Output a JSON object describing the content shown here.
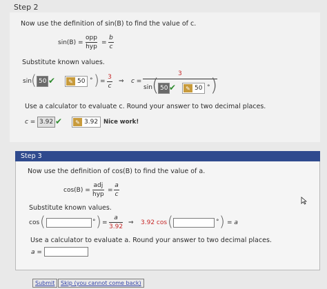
{
  "step2": {
    "label": "Step 2",
    "instruction": "Now use the definition of sin(B) to find the value of c.",
    "def_lhs": "sin(B) =",
    "def_num1": "opp",
    "def_den1": "hyp",
    "def_eq": "=",
    "def_num2": "b",
    "def_den2": "c",
    "substitute": "Substitute known values.",
    "sin": "sin",
    "angle_value": "50",
    "angle_input": "50",
    "degree": "°",
    "eq": "=",
    "num3": "3",
    "den_c": "c",
    "arrow": "⇒",
    "c_eq": "c =",
    "num3b": "3",
    "sin2": "sin",
    "angle_value2": "50",
    "angle_input2": "50",
    "calc_instruction": "Use a calculator to evaluate c. Round your answer to two decimal places.",
    "c_label": "c =",
    "c_value": "3.92",
    "c_input": "3.92",
    "feedback": "Nice work!"
  },
  "step3": {
    "title": "Step 3",
    "instruction": "Now use the definition of cos(B) to find the value of a.",
    "def_lhs": "cos(B) =",
    "def_num1": "adj",
    "def_den1": "hyp",
    "def_eq": "=",
    "def_num2": "a",
    "def_den2": "c",
    "substitute": "Substitute known values.",
    "cos": "cos",
    "degree": "°",
    "eq": "=",
    "num_a": "a",
    "den_392": "3.92",
    "arrow": "⇒",
    "coef": "3.92 cos",
    "rhs": "= a",
    "calc_instruction": "Use a calculator to evaluate a. Round your answer to two decimal places.",
    "a_label": "a ="
  },
  "footer": {
    "submit": "Submit",
    "skip": "Skip (you cannot come back)"
  }
}
